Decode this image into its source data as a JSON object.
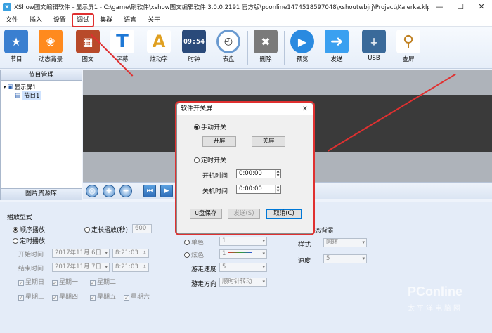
{
  "window": {
    "title": "XShow图文编辑软件 - 显示屏1 - C:\\game\\刷软件\\xshow图文编辑软件 3.0.0.2191 官方版\\pconline1474518597048\\xshoutwbjrj\\Project\\Kalerka.klp",
    "minimize": "—",
    "maximize": "☐",
    "close": "✕"
  },
  "menu": [
    "文件",
    "插入",
    "设置",
    "调试",
    "集群",
    "语言",
    "关于"
  ],
  "toolbar": [
    {
      "label": "节目",
      "icon": "star-icon",
      "color": "#3a7fd0"
    },
    {
      "label": "动态背景",
      "icon": "fish-icon",
      "color": "#ff8a1e"
    },
    {
      "label": "图文",
      "icon": "picture-icon",
      "color": "#b84a2a"
    },
    {
      "label": "字幕",
      "icon": "text-icon",
      "color": "#1e78d6"
    },
    {
      "label": "炫动字",
      "icon": "magic-text-icon",
      "color": "#e0a020"
    },
    {
      "label": "时钟",
      "icon": "digital-clock-icon",
      "color": "#2a4a7a"
    },
    {
      "label": "表盘",
      "icon": "analog-clock-icon",
      "color": "#6a9ad0"
    },
    {
      "label": "删除",
      "icon": "trash-icon",
      "color": "#7a7a7a"
    },
    {
      "label": "预览",
      "icon": "play-icon",
      "color": "#2a8ae0"
    },
    {
      "label": "发送",
      "icon": "send-arrow-icon",
      "color": "#3aa0f0"
    },
    {
      "label": "USB",
      "icon": "usb-icon",
      "color": "#3a6a9a"
    },
    {
      "label": "查屏",
      "icon": "magnifier-icon",
      "color": "#c08020"
    }
  ],
  "left_panel": {
    "header": "节目管理",
    "tree_root": "显示屏1",
    "tree_child": "节目1",
    "footer": "图片资源库"
  },
  "zoom_tools": [
    "zoom-fit-icon",
    "zoom-in-icon",
    "zoom-out-icon",
    "first-frame-icon",
    "next-frame-icon"
  ],
  "bottom": {
    "play_mode_title": "播放型式",
    "sequential": "顺序播放",
    "fixed_length": "定长播放(秒)",
    "fixed_length_value": "600",
    "timed": "定时播放",
    "start_time_label": "开始时间",
    "end_time_label": "结束时间",
    "start_date": "2017年11月 6日",
    "start_time": "8:21:03",
    "end_date": "2017年11月 7日",
    "end_time": "8:21:03",
    "weekdays": [
      "星期日",
      "星期一",
      "星期二",
      "星期三",
      "星期四",
      "星期五",
      "星期六"
    ],
    "border_single": "单色",
    "border_single_value": "1",
    "border_fancy": "炫色",
    "border_fancy_value": "1",
    "speed_label": "游走速度",
    "speed_value": "5",
    "direction_label": "游走方向",
    "direction_value": "顺时针转动",
    "bg_title": "态背景",
    "style_label": "样式",
    "style_value": "圆环",
    "rate_label": "速度",
    "rate_value": "5"
  },
  "dialog": {
    "title": "软件开关屏",
    "close": "✕",
    "manual": "手动开关",
    "open_btn": "开屏",
    "close_btn": "关屏",
    "timed": "定时开关",
    "on_time_label": "开机时间",
    "on_time": "0:00:00",
    "off_time_label": "关机时间",
    "off_time": "0:00:00",
    "usb_save": "u盘保存",
    "send": "发送(S)",
    "cancel": "取消(C)"
  },
  "watermark": {
    "brand": "PConline",
    "sub": "太平洋电脑网"
  },
  "annotation_color": "#e03030"
}
